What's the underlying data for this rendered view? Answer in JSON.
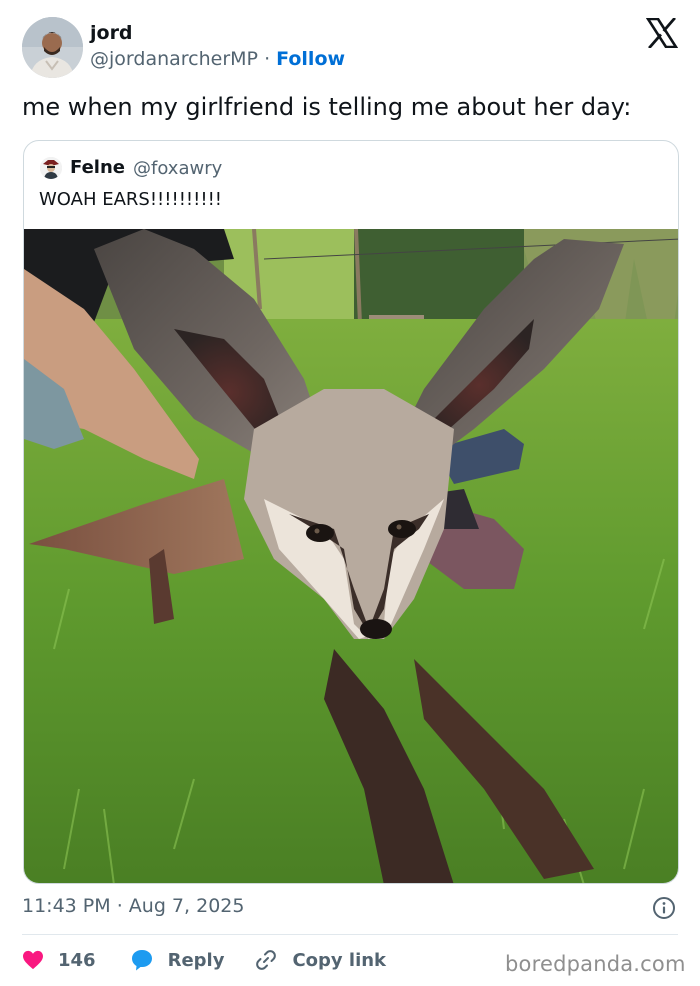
{
  "author": {
    "name": "jord",
    "handle": "@jordanarcherMP",
    "separator": "·",
    "follow_label": "Follow"
  },
  "tweet": {
    "text": "me when my girlfriend is telling me about her day:"
  },
  "quoted": {
    "name": "Felne",
    "handle": "@foxawry",
    "text": "WOAH EARS!!!!!!!!!!",
    "photo_icon": "bat-eared-fox-on-grass-photo"
  },
  "meta": {
    "time": "11:43 PM",
    "dot": "·",
    "date": "Aug 7, 2025"
  },
  "actions": {
    "like_count": "146",
    "reply_label": "Reply",
    "copy_label": "Copy link"
  },
  "watermark": "boredpanda.com",
  "colors": {
    "follow_blue": "#006fd6",
    "like_red": "#f91880",
    "reply_blue": "#1d9bf0",
    "muted_text": "#536471"
  }
}
